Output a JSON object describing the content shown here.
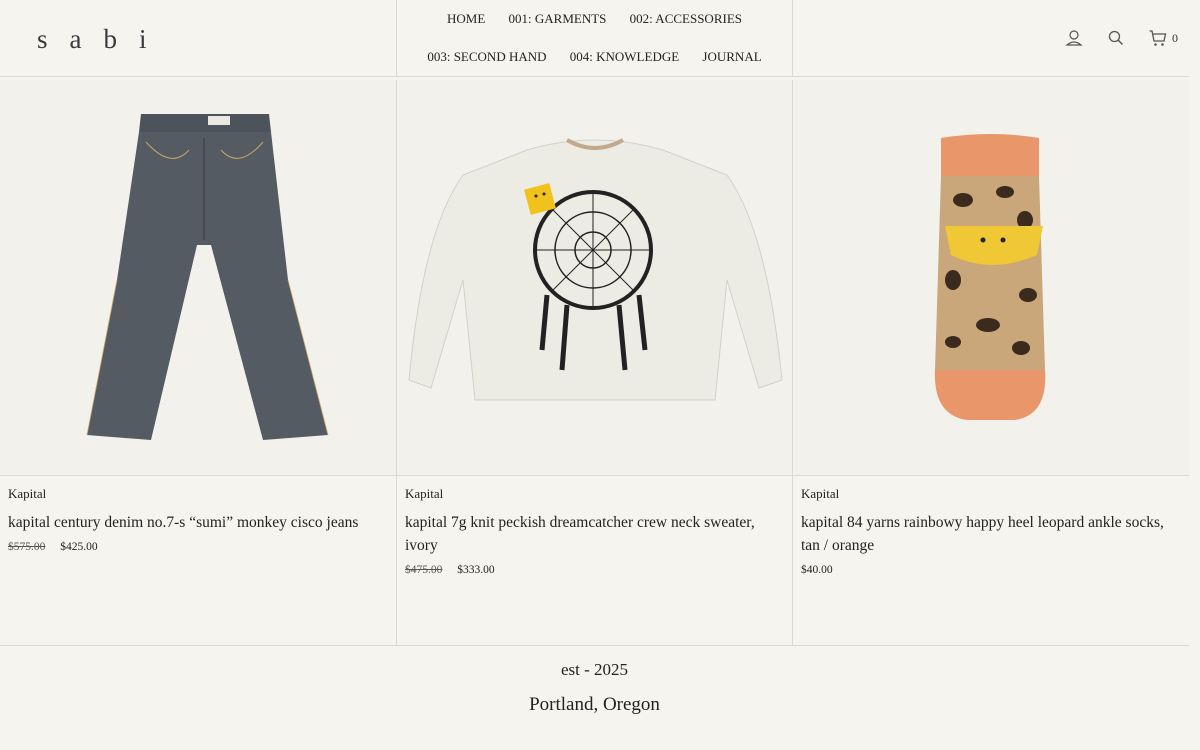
{
  "header": {
    "logo": "sabi",
    "nav_row1": [
      "HOME",
      "001: GARMENTS",
      "002: ACCESSORIES"
    ],
    "nav_row2": [
      "003: SECOND HAND",
      "004: KNOWLEDGE",
      "JOURNAL"
    ],
    "cart_count": "0",
    "icons": [
      "account-icon",
      "search-icon",
      "cart-icon"
    ]
  },
  "products": [
    {
      "brand": "Kapital",
      "title": "kapital century denim no.7-s “sumi” monkey cisco jeans",
      "old_price": "$575.00",
      "price": "$425.00",
      "image": "jeans"
    },
    {
      "brand": "Kapital",
      "title": "kapital 7g knit peckish dreamcatcher crew neck sweater, ivory",
      "old_price": "$475.00",
      "price": "$333.00",
      "image": "sweater"
    },
    {
      "brand": "Kapital",
      "title": "kapital 84 yarns rainbowy happy heel leopard ankle socks, tan / orange",
      "old_price": "",
      "price": "$40.00",
      "image": "socks"
    }
  ],
  "footer": {
    "est": "est - 2025",
    "city": "Portland, Oregon"
  }
}
